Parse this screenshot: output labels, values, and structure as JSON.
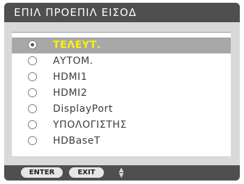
{
  "window": {
    "title": "ΕΠΙΛ ΠΡΟΕΠΙΛ ΕΙΣΟΔ"
  },
  "options": [
    {
      "label": "ΤΕΛΕΥΤ.",
      "selected": true
    },
    {
      "label": "ΑΥΤΟΜ.",
      "selected": false
    },
    {
      "label": "HDMI1",
      "selected": false
    },
    {
      "label": "HDMI2",
      "selected": false
    },
    {
      "label": "DisplayPort",
      "selected": false
    },
    {
      "label": "ΥΠΟΛΟΓΙΣΤΗΣ",
      "selected": false
    },
    {
      "label": "HDBaseT",
      "selected": false
    }
  ],
  "footer": {
    "enter_label": "ENTER",
    "exit_label": "EXIT",
    "nav_icon": "up-down-arrows-icon"
  },
  "colors": {
    "titlebar": "#4f4f4f",
    "body": "#d9d9d9",
    "highlight": "#a8a8a8",
    "selected_text": "#fff200"
  }
}
